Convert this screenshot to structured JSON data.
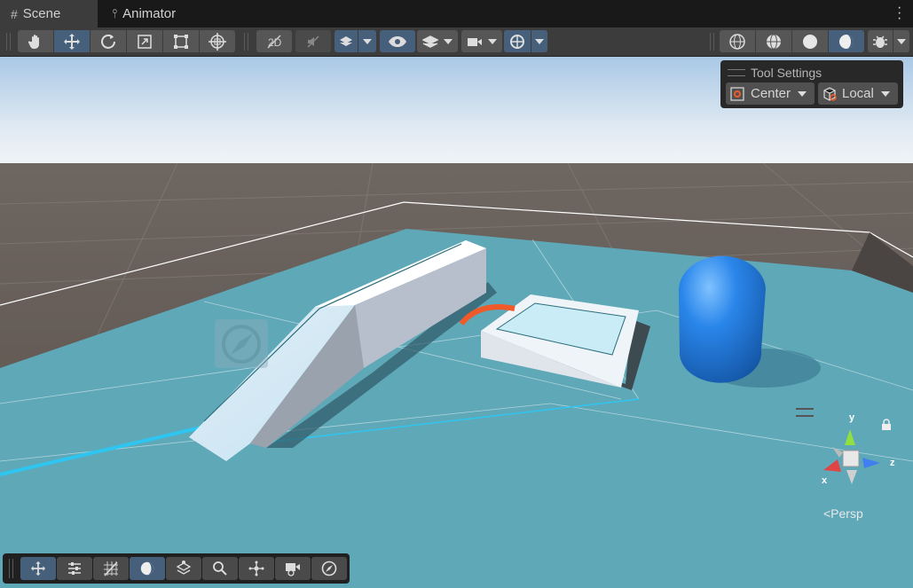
{
  "tabs": [
    {
      "label": "Scene",
      "icon": "grid-icon",
      "active": true
    },
    {
      "label": "Animator",
      "icon": "animator-icon",
      "active": false
    }
  ],
  "toolbar": {
    "tools": [
      "hand-tool",
      "move-tool",
      "rotate-tool",
      "scale-tool",
      "rect-tool",
      "transform-tool"
    ],
    "active_tool": "move-tool",
    "view_options": [
      "2d-toggle",
      "audio-toggle",
      "effects-dropdown",
      "visibility-toggle",
      "layers-dropdown",
      "camera-dropdown",
      "gizmos-dropdown"
    ],
    "shading_modes": [
      "wireframe-shading",
      "shaded-wireframe",
      "shaded",
      "lit"
    ],
    "active_shading": "lit"
  },
  "tool_settings": {
    "title": "Tool Settings",
    "pivot_position": "Center",
    "pivot_rotation": "Local"
  },
  "gizmo": {
    "y_label": "y",
    "z_label": "z",
    "x_label": "x",
    "projection_label": "<Persp"
  },
  "bottom_toolbar": {
    "tools": [
      "move-overlay",
      "transform-settings",
      "grid-snapping",
      "view-lighting",
      "layers-view",
      "search",
      "pivot-center",
      "camera-preview",
      "navigation"
    ],
    "active": [
      "move-overlay",
      "view-lighting"
    ]
  },
  "colors": {
    "accent": "#46607c",
    "sky_top": "#a9c8e6",
    "ground": "#5a504a",
    "floor": "#5fa8b8",
    "capsule": "#1f6fd0",
    "gizmo_y": "#8fe040",
    "gizmo_z": "#3f7ff0",
    "gizmo_x": "#e04545"
  }
}
